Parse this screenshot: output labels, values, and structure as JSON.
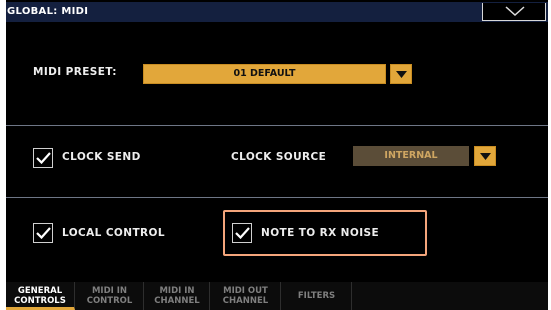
{
  "window": {
    "title": "GLOBAL: MIDI"
  },
  "midi_preset": {
    "label": "MIDI PRESET:",
    "value": "01 DEFAULT"
  },
  "clock_send": {
    "label": "CLOCK SEND",
    "checked": true
  },
  "clock_source": {
    "label": "CLOCK SOURCE",
    "value": "INTERNAL",
    "enabled": false
  },
  "local_control": {
    "label": "LOCAL CONTROL",
    "checked": true
  },
  "note_to_rx_noise": {
    "label": "NOTE TO RX NOISE",
    "checked": true
  },
  "tabs": [
    {
      "line1": "GENERAL",
      "line2": "CONTROLS",
      "active": true
    },
    {
      "line1": "MIDI IN",
      "line2": "CONTROL",
      "active": false
    },
    {
      "line1": "MIDI IN",
      "line2": "CHANNEL",
      "active": false
    },
    {
      "line1": "MIDI OUT",
      "line2": "CHANNEL",
      "active": false
    },
    {
      "line1": "FILTERS",
      "line2": "",
      "active": false
    }
  ],
  "colors": {
    "accent": "#e2a73a",
    "title_bar": "#14203f",
    "highlight": "#f4a57b",
    "background": "#000000"
  },
  "icons": {
    "menu": "chevron-down-icon",
    "dropdown": "triangle-down-icon",
    "check": "check-icon"
  }
}
